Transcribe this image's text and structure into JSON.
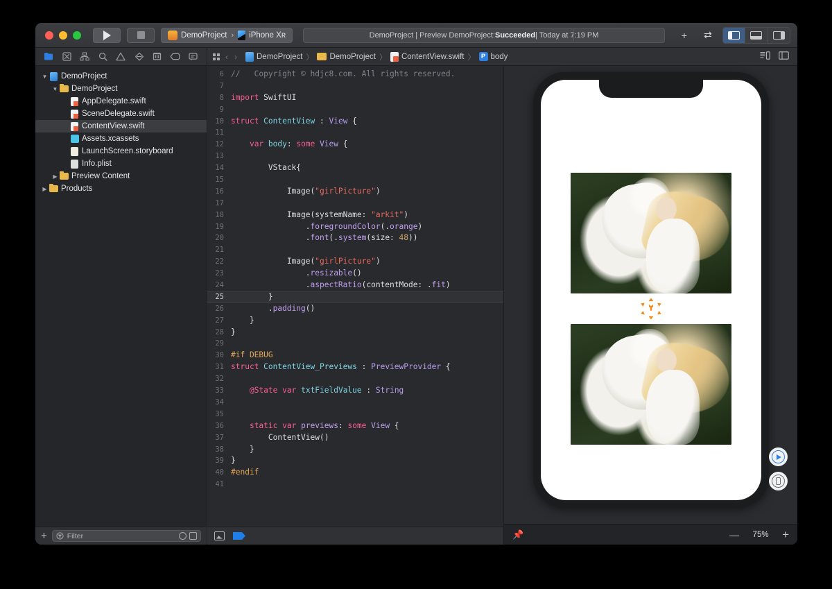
{
  "window": {
    "traffic_lights": [
      "close",
      "minimize",
      "zoom"
    ],
    "run_label": "Run",
    "stop_label": "Stop",
    "scheme": {
      "project": "DemoProject",
      "separator": "›",
      "device": "iPhone Xʀ"
    },
    "status": {
      "prefix": "DemoProject | Preview DemoProject: ",
      "result": "Succeeded",
      "suffix": " | Today at 7:19 PM"
    },
    "add_label": "+",
    "toggle_label": "⇄",
    "panels": [
      {
        "name": "navigator-panel-toggle",
        "active": true
      },
      {
        "name": "debug-panel-toggle",
        "active": false
      },
      {
        "name": "inspector-panel-toggle",
        "active": false
      }
    ]
  },
  "navigator_icons": [
    {
      "name": "project-navigator",
      "glyph": "folder",
      "active": true
    },
    {
      "name": "source-control-navigator",
      "glyph": "source-control",
      "active": false
    },
    {
      "name": "symbol-navigator",
      "glyph": "hierarchy",
      "active": false
    },
    {
      "name": "find-navigator",
      "glyph": "search",
      "active": false
    },
    {
      "name": "issue-navigator",
      "glyph": "warning",
      "active": false
    },
    {
      "name": "test-navigator",
      "glyph": "diamond",
      "active": false
    },
    {
      "name": "debug-navigator",
      "glyph": "gauge",
      "active": false
    },
    {
      "name": "breakpoint-navigator",
      "glyph": "tag",
      "active": false
    },
    {
      "name": "report-navigator",
      "glyph": "message",
      "active": false
    }
  ],
  "breadcrumb": [
    {
      "label": "DemoProject",
      "icon": "project-icon"
    },
    {
      "label": "DemoProject",
      "icon": "folder-icon"
    },
    {
      "label": "ContentView.swift",
      "icon": "swift-file-icon"
    },
    {
      "label": "body",
      "icon": "property-icon"
    }
  ],
  "breadcrumb_separator": "〉",
  "tree": [
    {
      "label": "DemoProject",
      "indent": 0,
      "twisty": "▼",
      "icon": "project",
      "selected": false
    },
    {
      "label": "DemoProject",
      "indent": 1,
      "twisty": "▼",
      "icon": "folder",
      "selected": false
    },
    {
      "label": "AppDelegate.swift",
      "indent": 2,
      "twisty": "",
      "icon": "swift",
      "selected": false
    },
    {
      "label": "SceneDelegate.swift",
      "indent": 2,
      "twisty": "",
      "icon": "swift",
      "selected": false
    },
    {
      "label": "ContentView.swift",
      "indent": 2,
      "twisty": "",
      "icon": "swift",
      "selected": true
    },
    {
      "label": "Assets.xcassets",
      "indent": 2,
      "twisty": "",
      "icon": "assets",
      "selected": false
    },
    {
      "label": "LaunchScreen.storyboard",
      "indent": 2,
      "twisty": "",
      "icon": "story",
      "selected": false
    },
    {
      "label": "Info.plist",
      "indent": 2,
      "twisty": "",
      "icon": "plist",
      "selected": false
    },
    {
      "label": "Preview Content",
      "indent": 1,
      "twisty": "▶",
      "icon": "folder",
      "selected": false
    },
    {
      "label": "Products",
      "indent": 0,
      "twisty": "▶",
      "icon": "folder",
      "selected": false
    }
  ],
  "filter": {
    "placeholder": "Filter",
    "add_label": "+"
  },
  "code": {
    "current_line": 25,
    "lines": [
      {
        "n": 6,
        "tokens": [
          {
            "t": "//   Copyright © hdjc8.com. All rights reserved.",
            "c": "cm"
          }
        ]
      },
      {
        "n": 7,
        "tokens": []
      },
      {
        "n": 8,
        "tokens": [
          {
            "t": "import",
            "c": "k"
          },
          {
            "t": " SwiftUI",
            "c": "src"
          }
        ]
      },
      {
        "n": 9,
        "tokens": []
      },
      {
        "n": 10,
        "tokens": [
          {
            "t": "struct",
            "c": "k"
          },
          {
            "t": " ",
            "c": "src"
          },
          {
            "t": "ContentView",
            "c": "ty"
          },
          {
            "t": " : ",
            "c": "src"
          },
          {
            "t": "View",
            "c": "tyv"
          },
          {
            "t": " {",
            "c": "src"
          }
        ]
      },
      {
        "n": 11,
        "tokens": []
      },
      {
        "n": 12,
        "tokens": [
          {
            "t": "    ",
            "c": "src"
          },
          {
            "t": "var",
            "c": "k"
          },
          {
            "t": " ",
            "c": "src"
          },
          {
            "t": "body",
            "c": "ty"
          },
          {
            "t": ": ",
            "c": "src"
          },
          {
            "t": "some",
            "c": "k"
          },
          {
            "t": " ",
            "c": "src"
          },
          {
            "t": "View",
            "c": "tyv"
          },
          {
            "t": " {",
            "c": "src"
          }
        ]
      },
      {
        "n": 13,
        "tokens": []
      },
      {
        "n": 14,
        "tokens": [
          {
            "t": "        VStack{",
            "c": "src"
          }
        ]
      },
      {
        "n": 15,
        "tokens": []
      },
      {
        "n": 16,
        "tokens": [
          {
            "t": "            Image(",
            "c": "src"
          },
          {
            "t": "\"girlPicture\"",
            "c": "st"
          },
          {
            "t": ")",
            "c": "src"
          }
        ]
      },
      {
        "n": 17,
        "tokens": []
      },
      {
        "n": 18,
        "tokens": [
          {
            "t": "            Image(systemName: ",
            "c": "src"
          },
          {
            "t": "\"arkit\"",
            "c": "st"
          },
          {
            "t": ")",
            "c": "src"
          }
        ]
      },
      {
        "n": 19,
        "tokens": [
          {
            "t": "                .",
            "c": "src"
          },
          {
            "t": "foregroundColor",
            "c": "m"
          },
          {
            "t": "(.",
            "c": "src"
          },
          {
            "t": "orange",
            "c": "m"
          },
          {
            "t": ")",
            "c": "src"
          }
        ]
      },
      {
        "n": 20,
        "tokens": [
          {
            "t": "                .",
            "c": "src"
          },
          {
            "t": "font",
            "c": "m"
          },
          {
            "t": "(.",
            "c": "src"
          },
          {
            "t": "system",
            "c": "m"
          },
          {
            "t": "(size: ",
            "c": "src"
          },
          {
            "t": "48",
            "c": "n"
          },
          {
            "t": "))",
            "c": "src"
          }
        ]
      },
      {
        "n": 21,
        "tokens": []
      },
      {
        "n": 22,
        "tokens": [
          {
            "t": "            Image(",
            "c": "src"
          },
          {
            "t": "\"girlPicture\"",
            "c": "st"
          },
          {
            "t": ")",
            "c": "src"
          }
        ]
      },
      {
        "n": 23,
        "tokens": [
          {
            "t": "                .",
            "c": "src"
          },
          {
            "t": "resizable",
            "c": "m"
          },
          {
            "t": "()",
            "c": "src"
          }
        ]
      },
      {
        "n": 24,
        "tokens": [
          {
            "t": "                .",
            "c": "src"
          },
          {
            "t": "aspectRatio",
            "c": "m"
          },
          {
            "t": "(contentMode: .",
            "c": "src"
          },
          {
            "t": "fit",
            "c": "m"
          },
          {
            "t": ")",
            "c": "src"
          }
        ]
      },
      {
        "n": 25,
        "tokens": [
          {
            "t": "        }",
            "c": "src"
          }
        ]
      },
      {
        "n": 26,
        "tokens": [
          {
            "t": "        .",
            "c": "src"
          },
          {
            "t": "padding",
            "c": "m"
          },
          {
            "t": "()",
            "c": "src"
          }
        ]
      },
      {
        "n": 27,
        "tokens": [
          {
            "t": "    }",
            "c": "src"
          }
        ]
      },
      {
        "n": 28,
        "tokens": [
          {
            "t": "}",
            "c": "src"
          }
        ]
      },
      {
        "n": 29,
        "tokens": []
      },
      {
        "n": 30,
        "tokens": [
          {
            "t": "#if DEBUG",
            "c": "pp"
          }
        ]
      },
      {
        "n": 31,
        "tokens": [
          {
            "t": "struct",
            "c": "k"
          },
          {
            "t": " ",
            "c": "src"
          },
          {
            "t": "ContentView_Previews",
            "c": "ty"
          },
          {
            "t": " : ",
            "c": "src"
          },
          {
            "t": "PreviewProvider",
            "c": "tyv"
          },
          {
            "t": " {",
            "c": "src"
          }
        ]
      },
      {
        "n": 32,
        "tokens": []
      },
      {
        "n": 33,
        "tokens": [
          {
            "t": "    ",
            "c": "src"
          },
          {
            "t": "@State",
            "c": "at"
          },
          {
            "t": " ",
            "c": "src"
          },
          {
            "t": "var",
            "c": "k"
          },
          {
            "t": " ",
            "c": "src"
          },
          {
            "t": "txtFieldValue",
            "c": "ty"
          },
          {
            "t": " : ",
            "c": "src"
          },
          {
            "t": "String",
            "c": "tyv"
          }
        ]
      },
      {
        "n": 34,
        "tokens": []
      },
      {
        "n": 35,
        "tokens": []
      },
      {
        "n": 36,
        "tokens": [
          {
            "t": "    ",
            "c": "src"
          },
          {
            "t": "static",
            "c": "k"
          },
          {
            "t": " ",
            "c": "src"
          },
          {
            "t": "var",
            "c": "k"
          },
          {
            "t": " ",
            "c": "src"
          },
          {
            "t": "previews",
            "c": "m"
          },
          {
            "t": ": ",
            "c": "src"
          },
          {
            "t": "some",
            "c": "k"
          },
          {
            "t": " ",
            "c": "src"
          },
          {
            "t": "View",
            "c": "tyv"
          },
          {
            "t": " {",
            "c": "src"
          }
        ]
      },
      {
        "n": 37,
        "tokens": [
          {
            "t": "        ContentView()",
            "c": "src"
          }
        ]
      },
      {
        "n": 38,
        "tokens": [
          {
            "t": "    }",
            "c": "src"
          }
        ]
      },
      {
        "n": 39,
        "tokens": [
          {
            "t": "}",
            "c": "src"
          }
        ]
      },
      {
        "n": 40,
        "tokens": [
          {
            "t": "#endif",
            "c": "pp"
          }
        ]
      },
      {
        "n": 41,
        "tokens": []
      }
    ]
  },
  "canvas": {
    "device": "iPhone Xʀ",
    "zoom": "75%",
    "zoom_out_label": "—",
    "zoom_in_label": "+",
    "pin_label": "Pin preview",
    "live_preview_label": "Live Preview",
    "device_preview_label": "Preview on Device",
    "arkit_glyph": "✳",
    "images": [
      {
        "name": "girl-picture-top",
        "alt": "white horse and blonde woman in white dress"
      },
      {
        "name": "girl-picture-bottom",
        "alt": "white horse and blonde woman in white dress"
      }
    ]
  },
  "colors": {
    "accent": "#2f7fe0",
    "orange": "#f08a1d",
    "window_bg": "#292a2e",
    "navigator_bg": "#252629",
    "string": "#e86b5d",
    "keyword": "#fa5f8e"
  }
}
